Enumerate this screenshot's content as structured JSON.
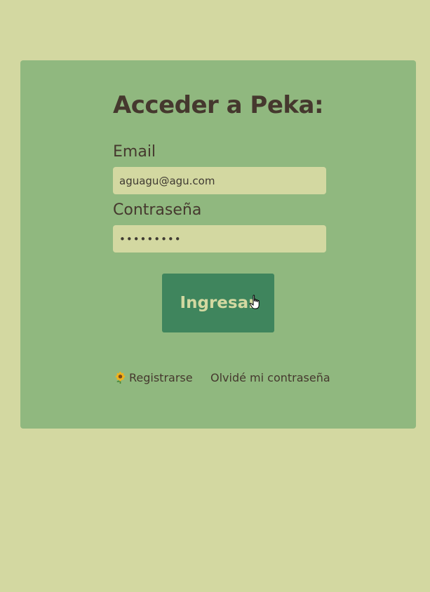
{
  "login": {
    "title": "Acceder a Peka:",
    "email_label": "Email",
    "email_value": "aguagu@agu.com",
    "password_label": "Contraseña",
    "password_value": "•••••••••",
    "submit_label": "Ingresar",
    "register_label": "Registrarse",
    "forgot_label": "Olvidé mi contraseña",
    "register_icon": "sunflower-icon"
  },
  "colors": {
    "background": "#d3d8a1",
    "card": "#90b87f",
    "button": "#3f855d",
    "button_text": "#d3d8a1",
    "text": "#45382e"
  }
}
